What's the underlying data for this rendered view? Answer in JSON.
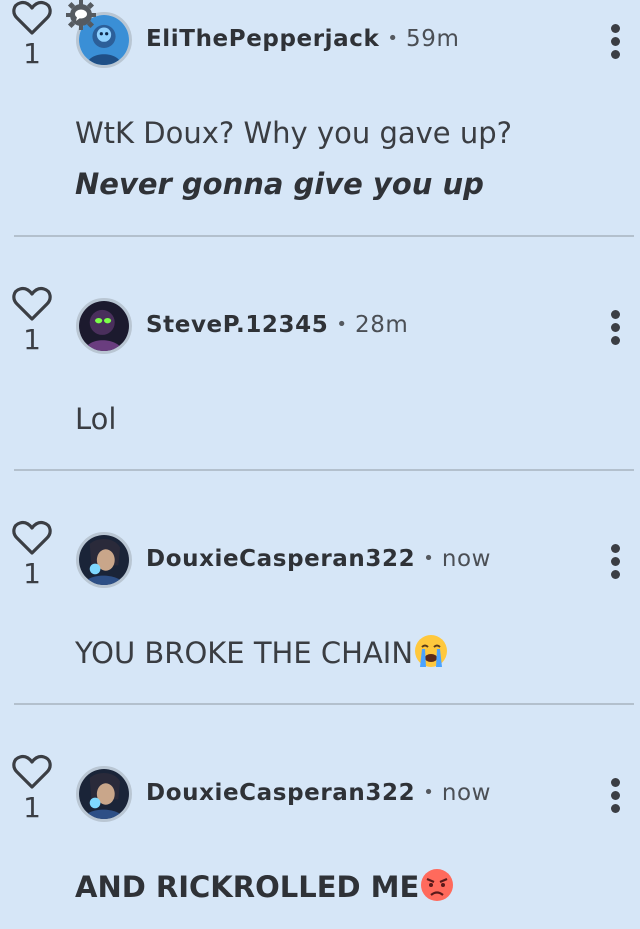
{
  "comments": [
    {
      "likes": "1",
      "username": "EliThePepperjack",
      "separator": "•",
      "time": "59m",
      "lines": [
        "WtK Doux? Why you gave up?",
        "Never gonna give you up"
      ],
      "avatar": "avatar-blue-character"
    },
    {
      "likes": "1",
      "username": "SteveP.12345",
      "separator": "•",
      "time": "28m",
      "lines": [
        "Lol"
      ],
      "avatar": "avatar-dark-green-glow"
    },
    {
      "likes": "1",
      "username": "DouxieCasperan322",
      "separator": "•",
      "time": "now",
      "lines": [
        "YOU BROKE THE CHAIN"
      ],
      "emoji": "crying-face",
      "avatar": "avatar-wizard"
    },
    {
      "likes": "1",
      "username": "DouxieCasperan322",
      "separator": "•",
      "time": "now",
      "lines": [
        "AND RICKROLLED ME"
      ],
      "emoji": "angry-face",
      "avatar": "avatar-wizard"
    }
  ],
  "colors": {
    "background": "#d6e6f7",
    "divider": "#b3c0cd",
    "text": "#2f3237"
  }
}
